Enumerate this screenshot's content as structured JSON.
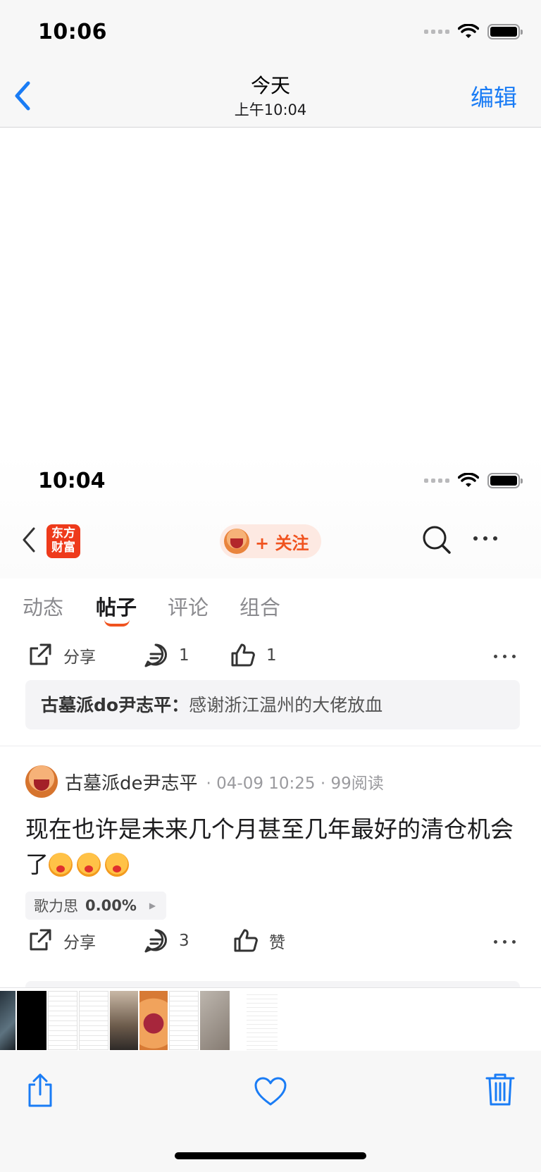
{
  "outer": {
    "status_time": "10:06",
    "nav_title": "今天",
    "nav_subtitle": "上午10:04",
    "edit_label": "编辑"
  },
  "screenshot": {
    "status_time": "10:04",
    "logo_line1": "东方",
    "logo_line2": "财富",
    "follow_label": "+ 关注",
    "tabs": [
      "动态",
      "帖子",
      "评论",
      "组合"
    ],
    "active_tab": "帖子",
    "first_actions": {
      "share": "分享",
      "comments": "1",
      "likes": "1"
    },
    "reply": {
      "author": "古墓派do尹志平：",
      "text": "感谢浙江温州的大佬放血"
    },
    "post": {
      "author": "古墓派de尹志平",
      "meta": "· 04-09 10:25 · 99阅读",
      "body": "现在也许是未来几个月甚至几年最好的清仓机会了",
      "stock_name": "歌力思",
      "stock_change": "0.00%"
    },
    "second_actions": {
      "share": "分享",
      "comments": "3",
      "likes": "赞"
    }
  },
  "colors": {
    "accent_blue": "#1a7cf5",
    "brand_orange": "#f0531f",
    "logo_red": "#ee3a1b"
  }
}
